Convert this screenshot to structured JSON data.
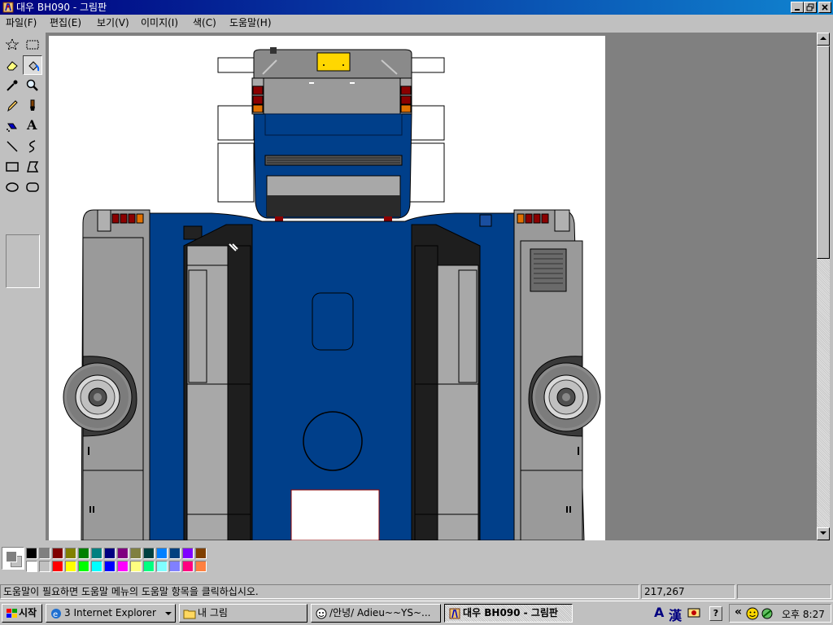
{
  "window": {
    "title": "대우 BH090 - 그림판"
  },
  "menu": {
    "file": "파일(F)",
    "edit": "편집(E)",
    "view": "보기(V)",
    "image": "이미지(I)",
    "colors": "색(C)",
    "help": "도움말(H)"
  },
  "toolbox": {
    "tools": [
      {
        "name": "free-select",
        "icon": "star-select-icon"
      },
      {
        "name": "rect-select",
        "icon": "rect-select-icon"
      },
      {
        "name": "eraser",
        "icon": "eraser-icon"
      },
      {
        "name": "fill",
        "icon": "paint-bucket-icon",
        "active": true
      },
      {
        "name": "pick-color",
        "icon": "eyedropper-icon"
      },
      {
        "name": "magnifier",
        "icon": "magnifier-icon"
      },
      {
        "name": "pencil",
        "icon": "pencil-icon"
      },
      {
        "name": "brush",
        "icon": "brush-icon"
      },
      {
        "name": "airbrush",
        "icon": "airbrush-icon"
      },
      {
        "name": "text",
        "icon": "text-icon",
        "glyph": "A"
      },
      {
        "name": "line",
        "icon": "line-icon"
      },
      {
        "name": "curve",
        "icon": "curve-icon"
      },
      {
        "name": "rectangle",
        "icon": "rectangle-icon"
      },
      {
        "name": "polygon",
        "icon": "polygon-icon"
      },
      {
        "name": "ellipse",
        "icon": "ellipse-icon"
      },
      {
        "name": "rounded-rect",
        "icon": "rounded-rect-icon"
      }
    ]
  },
  "drawing_colors": {
    "bus_blue": "#003f8a",
    "bus_gray": "#9a9a9a",
    "dark_gray": "#606060",
    "black_panel": "#1e1e1e",
    "lamp_red": "#8b0000",
    "lamp_orange": "#e07000",
    "plate_yellow": "#ffd700"
  },
  "palette": {
    "top": [
      "#000000",
      "#808080",
      "#800000",
      "#808000",
      "#008000",
      "#008080",
      "#000080",
      "#800080",
      "#808040",
      "#004040",
      "#0080ff",
      "#004080",
      "#8000ff",
      "#804000"
    ],
    "bottom": [
      "#ffffff",
      "#c0c0c0",
      "#ff0000",
      "#ffff00",
      "#00ff00",
      "#00ffff",
      "#0000ff",
      "#ff00ff",
      "#ffff80",
      "#00ff80",
      "#80ffff",
      "#8080ff",
      "#ff0080",
      "#ff8040"
    ]
  },
  "status": {
    "help": "도움말이 필요하면 도움말 메뉴의 도움말 항목을 클릭하십시오.",
    "coords": "217,267"
  },
  "taskbar": {
    "start": "시작",
    "tasks": [
      {
        "label": "3 Internet Explorer",
        "icon": "ie-icon"
      },
      {
        "label": "내 그림",
        "icon": "folder-icon"
      },
      {
        "label": "/안녕/ Adieu~~YS~...",
        "icon": "messenger-icon"
      },
      {
        "label": "대우 BH090 - 그림판",
        "icon": "paint-icon",
        "active": true
      }
    ],
    "ime_a": "A",
    "ime_han": "漢",
    "help_glyph": "?",
    "tray_arrow": "«",
    "clock": "오후 8:27"
  }
}
